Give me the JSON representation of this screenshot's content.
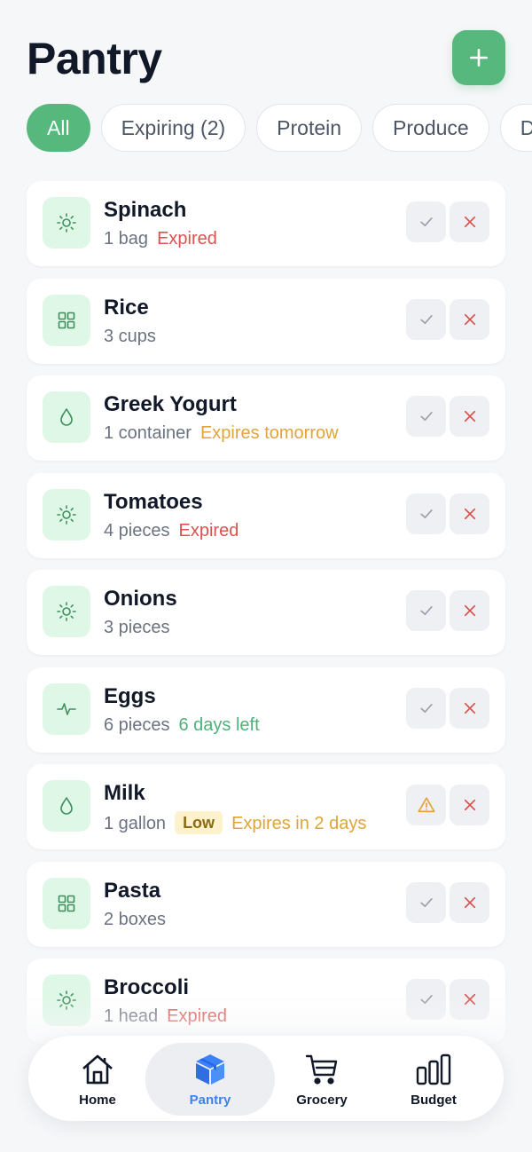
{
  "header": {
    "title": "Pantry",
    "add_icon": "plus-icon"
  },
  "filters": [
    {
      "label": "All",
      "active": true
    },
    {
      "label": "Expiring (2)",
      "active": false
    },
    {
      "label": "Protein",
      "active": false
    },
    {
      "label": "Produce",
      "active": false
    },
    {
      "label": "D",
      "active": false
    }
  ],
  "items": [
    {
      "name": "Spinach",
      "qty": "1 bag",
      "status": "Expired",
      "status_type": "expired",
      "badge": "",
      "icon": "sun-icon",
      "action_icon": "check-icon"
    },
    {
      "name": "Rice",
      "qty": "3 cups",
      "status": "",
      "status_type": "",
      "badge": "",
      "icon": "grid-icon",
      "action_icon": "check-icon"
    },
    {
      "name": "Greek Yogurt",
      "qty": "1 container",
      "status": "Expires tomorrow",
      "status_type": "soon",
      "badge": "",
      "icon": "droplet-icon",
      "action_icon": "check-icon"
    },
    {
      "name": "Tomatoes",
      "qty": "4 pieces",
      "status": "Expired",
      "status_type": "expired",
      "badge": "",
      "icon": "sun-icon",
      "action_icon": "check-icon"
    },
    {
      "name": "Onions",
      "qty": "3 pieces",
      "status": "",
      "status_type": "",
      "badge": "",
      "icon": "sun-icon",
      "action_icon": "check-icon"
    },
    {
      "name": "Eggs",
      "qty": "6 pieces",
      "status": "6 days left",
      "status_type": "ok",
      "badge": "",
      "icon": "activity-icon",
      "action_icon": "check-icon"
    },
    {
      "name": "Milk",
      "qty": "1 gallon",
      "status": "Expires in 2 days",
      "status_type": "soon",
      "badge": "Low",
      "icon": "droplet-icon",
      "action_icon": "warning-icon"
    },
    {
      "name": "Pasta",
      "qty": "2 boxes",
      "status": "",
      "status_type": "",
      "badge": "",
      "icon": "grid-icon",
      "action_icon": "check-icon"
    },
    {
      "name": "Broccoli",
      "qty": "1 head",
      "status": "Expired",
      "status_type": "expired",
      "badge": "",
      "icon": "sun-icon",
      "action_icon": "check-icon"
    }
  ],
  "nav": [
    {
      "label": "Home",
      "icon": "home-icon",
      "active": false
    },
    {
      "label": "Pantry",
      "icon": "box-icon",
      "active": true
    },
    {
      "label": "Grocery",
      "icon": "cart-icon",
      "active": false
    },
    {
      "label": "Budget",
      "icon": "bar-chart-icon",
      "active": false
    }
  ],
  "colors": {
    "accent": "#56b87c",
    "expired": "#d9534f",
    "expiring": "#e0a43a",
    "fresh": "#4fb07a",
    "active_nav": "#3b82f6"
  }
}
